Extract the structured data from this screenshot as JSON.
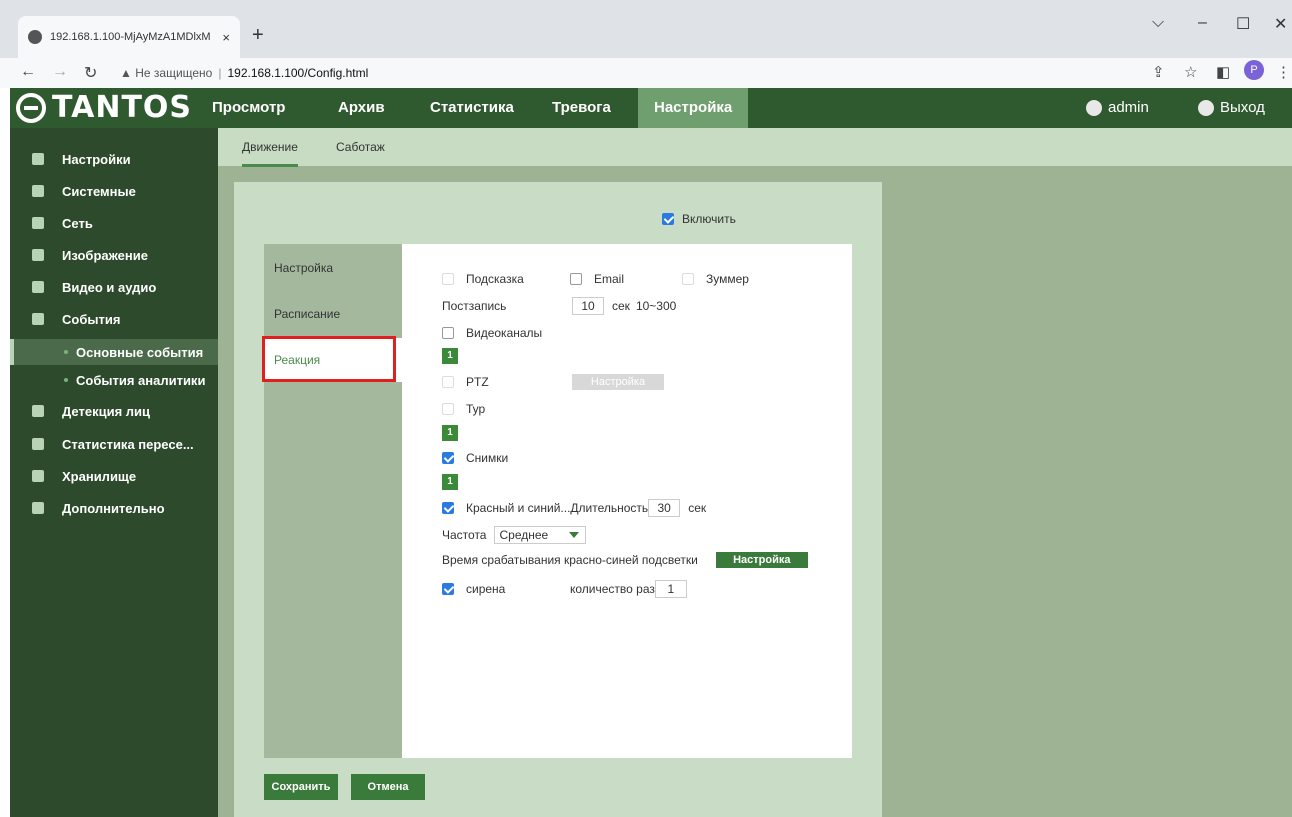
{
  "browser": {
    "tab_title": "192.168.1.100-MjAyMzA1MDlxM",
    "tab_close": "×",
    "new_tab": "+",
    "security_label": "Не защищено",
    "url": "192.168.1.100/Config.html",
    "profile_initial": "P"
  },
  "header": {
    "logo_text": "TANTOS",
    "nav": [
      "Просмотр",
      "Архив",
      "Статистика",
      "Тревога",
      "Настройка"
    ],
    "user": "admin",
    "logout": "Выход"
  },
  "sidebar": {
    "items": [
      "Настройки",
      "Системные",
      "Сеть",
      "Изображение",
      "Видео и аудио",
      "События"
    ],
    "subitems": [
      "Основные события",
      "События аналитики"
    ],
    "items_after": [
      "Детекция лиц",
      "Статистика пересе...",
      "Хранилище",
      "Дополнительно"
    ]
  },
  "subtabs": [
    "Движение",
    "Саботаж"
  ],
  "panel": {
    "enable_label": "Включить",
    "left_menu": [
      "Настройка",
      "Расписание",
      "Реакция"
    ],
    "form": {
      "hint": "Подсказка",
      "email": "Email",
      "buzzer": "Зуммер",
      "postrecord": "Постзапись",
      "postrecord_value": "10",
      "postrecord_unit": "сек",
      "postrecord_range": "10~300",
      "videochannels": "Видеоканалы",
      "channel_1": "1",
      "ptz": "PTZ",
      "ptz_button": "Настройка",
      "tour": "Тур",
      "channel_2": "1",
      "snapshots": "Снимки",
      "channel_3": "1",
      "redblue": "Красный и синий...Длительность",
      "redblue_value": "30",
      "redblue_unit": "сек",
      "frequency": "Частота",
      "frequency_value": "Среднее",
      "trigger_time": "Время срабатывания красно-синей подсветки",
      "trigger_button": "Настройка",
      "siren": "сирена",
      "count_label": "количество раз",
      "count_value": "1"
    },
    "save": "Сохранить",
    "cancel": "Отмена"
  }
}
